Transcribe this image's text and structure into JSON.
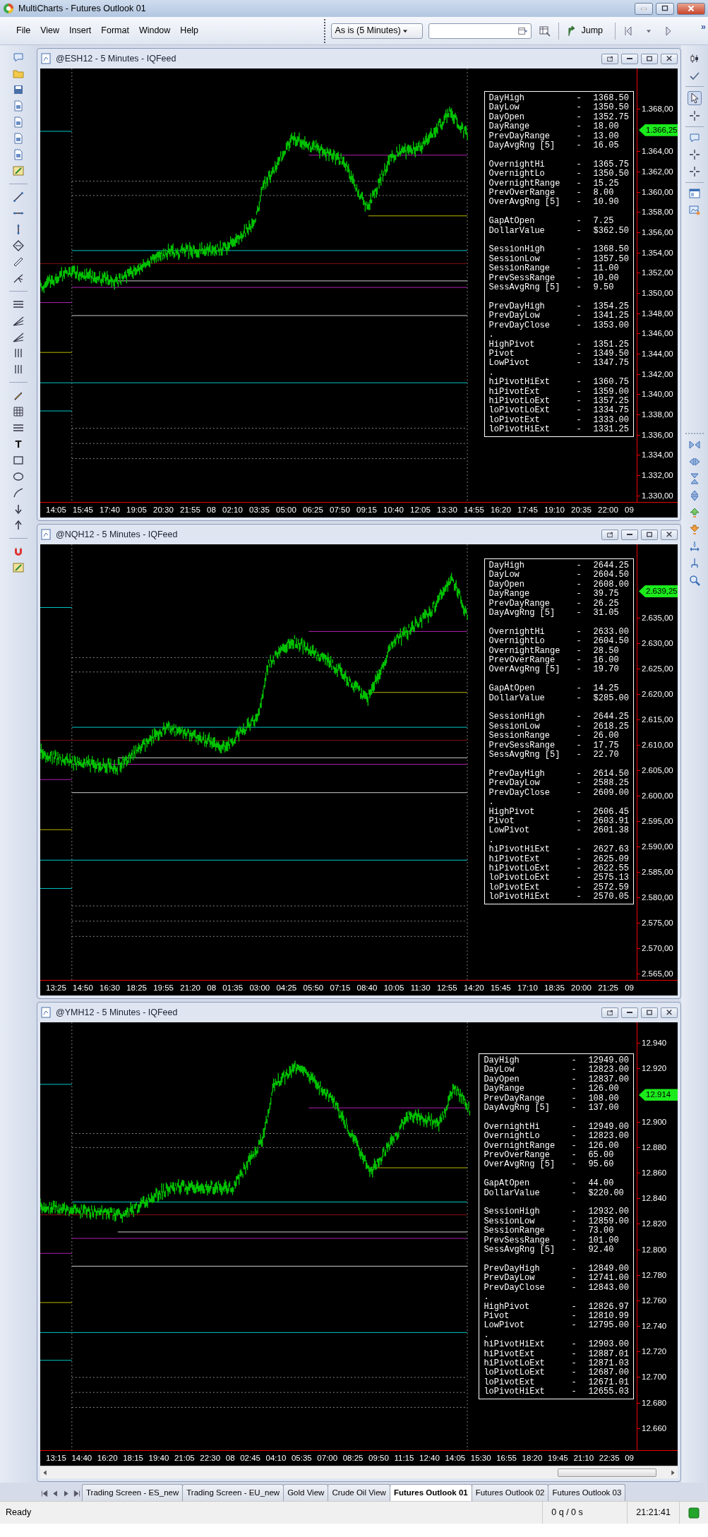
{
  "window": {
    "title": "MultiCharts - Futures Outlook 01"
  },
  "menu": [
    "File",
    "View",
    "Insert",
    "Format",
    "Window",
    "Help"
  ],
  "toolbar": {
    "resolution": "As is (5 Minutes)",
    "jump": "Jump",
    "overflow": "»"
  },
  "left_toolbar": {
    "text_tool": "T"
  },
  "charts": [
    {
      "title": "@ESH12 - 5 Minutes - IQFeed",
      "horizontal_scrollbar": false,
      "price_axis": [
        {
          "kind": "label",
          "text": "1.368,00"
        },
        {
          "kind": "last_price",
          "text": "1.366,25"
        },
        {
          "kind": "label",
          "text": "1.364,00"
        },
        {
          "kind": "label",
          "text": "1.362,00"
        },
        {
          "kind": "label",
          "text": "1.360,00"
        },
        {
          "kind": "label",
          "text": "1.358,00"
        },
        {
          "kind": "label",
          "text": "1.356,00"
        },
        {
          "kind": "label",
          "text": "1.354,00"
        },
        {
          "kind": "label",
          "text": "1.352,00"
        },
        {
          "kind": "label",
          "text": "1.350,00"
        },
        {
          "kind": "label",
          "text": "1.348,00"
        },
        {
          "kind": "label",
          "text": "1.346,00"
        },
        {
          "kind": "label",
          "text": "1.344,00"
        },
        {
          "kind": "label",
          "text": "1.342,00"
        },
        {
          "kind": "label",
          "text": "1.340,00"
        },
        {
          "kind": "label",
          "text": "1.338,00"
        },
        {
          "kind": "label",
          "text": "1.336,00"
        },
        {
          "kind": "label",
          "text": "1.334,00"
        },
        {
          "kind": "label",
          "text": "1.332,00"
        },
        {
          "kind": "label",
          "text": "1.330,00"
        }
      ],
      "time_axis": [
        "14:05",
        "15:45",
        "17:40",
        "19:05",
        "20:30",
        "21:55",
        "08",
        "02:10",
        "03:35",
        "05:00",
        "06:25",
        "07:50",
        "09:15",
        "10:40",
        "12:05",
        "13:30",
        "14:55",
        "16:20",
        "17:45",
        "19:10",
        "20:35",
        "22:00",
        "09"
      ],
      "stats": [
        {
          "kind": "row",
          "label": "DayHigh",
          "dash": "-",
          "value": "1368.50"
        },
        {
          "kind": "row",
          "label": "DayLow",
          "dash": "-",
          "value": "1350.50"
        },
        {
          "kind": "row",
          "label": "DayOpen",
          "dash": "-",
          "value": "1352.75"
        },
        {
          "kind": "row",
          "label": "DayRange",
          "dash": "-",
          "value": "18.00"
        },
        {
          "kind": "row",
          "label": "PrevDayRange",
          "dash": "-",
          "value": "13.00"
        },
        {
          "kind": "row",
          "label": "DayAvgRng [5]",
          "dash": "-",
          "value": "16.05"
        },
        {
          "kind": "blank"
        },
        {
          "kind": "row",
          "label": "OvernightHi",
          "dash": "-",
          "value": "1365.75"
        },
        {
          "kind": "row",
          "label": "OvernightLo",
          "dash": "-",
          "value": "1350.50"
        },
        {
          "kind": "row",
          "label": "OvernightRange",
          "dash": "-",
          "value": "15.25"
        },
        {
          "kind": "row",
          "label": "PrevOverRange",
          "dash": "-",
          "value": "8.00"
        },
        {
          "kind": "row",
          "label": "OverAvgRng [5]",
          "dash": "-",
          "value": "10.90"
        },
        {
          "kind": "blank"
        },
        {
          "kind": "row",
          "label": "GapAtOpen",
          "dash": "-",
          "value": "7.25"
        },
        {
          "kind": "row",
          "label": "DollarValue",
          "dash": "-",
          "value": "$362.50"
        },
        {
          "kind": "blank"
        },
        {
          "kind": "row",
          "label": "SessionHigh",
          "dash": "-",
          "value": "1368.50"
        },
        {
          "kind": "row",
          "label": "SessionLow",
          "dash": "-",
          "value": "1357.50"
        },
        {
          "kind": "row",
          "label": "SessionRange",
          "dash": "-",
          "value": "11.00"
        },
        {
          "kind": "row",
          "label": "PrevSessRange",
          "dash": "-",
          "value": "10.00"
        },
        {
          "kind": "row",
          "label": "SessAvgRng [5]",
          "dash": "-",
          "value": "9.50"
        },
        {
          "kind": "blank"
        },
        {
          "kind": "row",
          "label": "PrevDayHigh",
          "dash": "-",
          "value": "1354.25"
        },
        {
          "kind": "row",
          "label": "PrevDayLow",
          "dash": "-",
          "value": "1341.25"
        },
        {
          "kind": "row",
          "label": "PrevDayClose",
          "dash": "-",
          "value": "1353.00"
        },
        {
          "kind": "dot",
          "text": "."
        },
        {
          "kind": "row",
          "label": "HighPivot",
          "dash": "-",
          "value": "1351.25"
        },
        {
          "kind": "row",
          "label": "Pivot",
          "dash": "-",
          "value": "1349.50"
        },
        {
          "kind": "row",
          "label": "LowPivot",
          "dash": "-",
          "value": "1347.75"
        },
        {
          "kind": "dot",
          "text": "."
        },
        {
          "kind": "row",
          "label": "hiPivotHiExt",
          "dash": "-",
          "value": "1360.75"
        },
        {
          "kind": "row",
          "label": "hiPivotExt",
          "dash": "-",
          "value": "1359.00"
        },
        {
          "kind": "row",
          "label": "hiPivotLoExt",
          "dash": "-",
          "value": "1357.25"
        },
        {
          "kind": "row",
          "label": "loPivotLoExt",
          "dash": "-",
          "value": "1334.75"
        },
        {
          "kind": "row",
          "label": "loPivotExt",
          "dash": "-",
          "value": "1333.00"
        },
        {
          "kind": "row",
          "label": "loPivotHiExt",
          "dash": "-",
          "value": "1331.25"
        }
      ]
    },
    {
      "title": "@NQH12 - 5 Minutes - IQFeed",
      "horizontal_scrollbar": false,
      "price_axis": [
        {
          "kind": "last_price",
          "text": "2.639,25"
        },
        {
          "kind": "label",
          "text": "2.635,00"
        },
        {
          "kind": "label",
          "text": "2.630,00"
        },
        {
          "kind": "label",
          "text": "2.625,00"
        },
        {
          "kind": "label",
          "text": "2.620,00"
        },
        {
          "kind": "label",
          "text": "2.615,00"
        },
        {
          "kind": "label",
          "text": "2.610,00"
        },
        {
          "kind": "label",
          "text": "2.605,00"
        },
        {
          "kind": "label",
          "text": "2.600,00"
        },
        {
          "kind": "label",
          "text": "2.595,00"
        },
        {
          "kind": "label",
          "text": "2.590,00"
        },
        {
          "kind": "label",
          "text": "2.585,00"
        },
        {
          "kind": "label",
          "text": "2.580,00"
        },
        {
          "kind": "label",
          "text": "2.575,00"
        },
        {
          "kind": "label",
          "text": "2.570,00"
        },
        {
          "kind": "label",
          "text": "2.565,00"
        }
      ],
      "time_axis": [
        "13:25",
        "14:50",
        "16:30",
        "18:25",
        "19:55",
        "21:20",
        "08",
        "01:35",
        "03:00",
        "04:25",
        "05:50",
        "07:15",
        "08:40",
        "10:05",
        "11:30",
        "12:55",
        "14:20",
        "15:45",
        "17:10",
        "18:35",
        "20:00",
        "21:25",
        "09"
      ],
      "stats": [
        {
          "kind": "row",
          "label": "DayHigh",
          "dash": "-",
          "value": "2644.25"
        },
        {
          "kind": "row",
          "label": "DayLow",
          "dash": "-",
          "value": "2604.50"
        },
        {
          "kind": "row",
          "label": "DayOpen",
          "dash": "-",
          "value": "2608.00"
        },
        {
          "kind": "row",
          "label": "DayRange",
          "dash": "-",
          "value": "39.75"
        },
        {
          "kind": "row",
          "label": "PrevDayRange",
          "dash": "-",
          "value": "26.25"
        },
        {
          "kind": "row",
          "label": "DayAvgRng [5]",
          "dash": "-",
          "value": "31.05"
        },
        {
          "kind": "blank"
        },
        {
          "kind": "row",
          "label": "OvernightHi",
          "dash": "-",
          "value": "2633.00"
        },
        {
          "kind": "row",
          "label": "OvernightLo",
          "dash": "-",
          "value": "2604.50"
        },
        {
          "kind": "row",
          "label": "OvernightRange",
          "dash": "-",
          "value": "28.50"
        },
        {
          "kind": "row",
          "label": "PrevOverRange",
          "dash": "-",
          "value": "16.00"
        },
        {
          "kind": "row",
          "label": "OverAvgRng [5]",
          "dash": "-",
          "value": "19.70"
        },
        {
          "kind": "blank"
        },
        {
          "kind": "row",
          "label": "GapAtOpen",
          "dash": "-",
          "value": "14.25"
        },
        {
          "kind": "row",
          "label": "DollarValue",
          "dash": "-",
          "value": "$285.00"
        },
        {
          "kind": "blank"
        },
        {
          "kind": "row",
          "label": "SessionHigh",
          "dash": "-",
          "value": "2644.25"
        },
        {
          "kind": "row",
          "label": "SessionLow",
          "dash": "-",
          "value": "2618.25"
        },
        {
          "kind": "row",
          "label": "SessionRange",
          "dash": "-",
          "value": "26.00"
        },
        {
          "kind": "row",
          "label": "PrevSessRange",
          "dash": "-",
          "value": "17.75"
        },
        {
          "kind": "row",
          "label": "SessAvgRng [5]",
          "dash": "-",
          "value": "22.70"
        },
        {
          "kind": "blank"
        },
        {
          "kind": "row",
          "label": "PrevDayHigh",
          "dash": "-",
          "value": "2614.50"
        },
        {
          "kind": "row",
          "label": "PrevDayLow",
          "dash": "-",
          "value": "2588.25"
        },
        {
          "kind": "row",
          "label": "PrevDayClose",
          "dash": "-",
          "value": "2609.00"
        },
        {
          "kind": "dot",
          "text": "."
        },
        {
          "kind": "row",
          "label": "HighPivot",
          "dash": "-",
          "value": "2606.45"
        },
        {
          "kind": "row",
          "label": "Pivot",
          "dash": "-",
          "value": "2603.91"
        },
        {
          "kind": "row",
          "label": "LowPivot",
          "dash": "-",
          "value": "2601.38"
        },
        {
          "kind": "dot",
          "text": "."
        },
        {
          "kind": "row",
          "label": "hiPivotHiExt",
          "dash": "-",
          "value": "2627.63"
        },
        {
          "kind": "row",
          "label": "hiPivotExt",
          "dash": "-",
          "value": "2625.09"
        },
        {
          "kind": "row",
          "label": "hiPivotLoExt",
          "dash": "-",
          "value": "2622.55"
        },
        {
          "kind": "row",
          "label": "loPivotLoExt",
          "dash": "-",
          "value": "2575.13"
        },
        {
          "kind": "row",
          "label": "loPivotExt",
          "dash": "-",
          "value": "2572.59"
        },
        {
          "kind": "row",
          "label": "loPivotHiExt",
          "dash": "-",
          "value": "2570.05"
        }
      ]
    },
    {
      "title": "@YMH12 - 5 Minutes - IQFeed",
      "horizontal_scrollbar": true,
      "price_axis": [
        {
          "kind": "label",
          "text": "12.940"
        },
        {
          "kind": "label",
          "text": "12.920"
        },
        {
          "kind": "last_price",
          "text": "12.914"
        },
        {
          "kind": "label",
          "text": "12.900"
        },
        {
          "kind": "label",
          "text": "12.880"
        },
        {
          "kind": "label",
          "text": "12.860"
        },
        {
          "kind": "label",
          "text": "12.840"
        },
        {
          "kind": "label",
          "text": "12.820"
        },
        {
          "kind": "label",
          "text": "12.800"
        },
        {
          "kind": "label",
          "text": "12.780"
        },
        {
          "kind": "label",
          "text": "12.760"
        },
        {
          "kind": "label",
          "text": "12.740"
        },
        {
          "kind": "label",
          "text": "12.720"
        },
        {
          "kind": "label",
          "text": "12.700"
        },
        {
          "kind": "label",
          "text": "12.680"
        },
        {
          "kind": "label",
          "text": "12.660"
        }
      ],
      "time_axis": [
        "13:15",
        "14:40",
        "16:20",
        "18:15",
        "19:40",
        "21:05",
        "22:30",
        "08",
        "02:45",
        "04:10",
        "05:35",
        "07:00",
        "08:25",
        "09:50",
        "11:15",
        "12:40",
        "14:05",
        "15:30",
        "16:55",
        "18:20",
        "19:45",
        "21:10",
        "22:35",
        "09"
      ],
      "stats": [
        {
          "kind": "row",
          "label": "DayHigh",
          "dash": "-",
          "value": "12949.00"
        },
        {
          "kind": "row",
          "label": "DayLow",
          "dash": "-",
          "value": "12823.00"
        },
        {
          "kind": "row",
          "label": "DayOpen",
          "dash": "-",
          "value": "12837.00"
        },
        {
          "kind": "row",
          "label": "DayRange",
          "dash": "-",
          "value": "126.00"
        },
        {
          "kind": "row",
          "label": "PrevDayRange",
          "dash": "-",
          "value": "108.00"
        },
        {
          "kind": "row",
          "label": "DayAvgRng [5]",
          "dash": "-",
          "value": "137.00"
        },
        {
          "kind": "blank"
        },
        {
          "kind": "row",
          "label": "OvernightHi",
          "dash": "-",
          "value": "12949.00"
        },
        {
          "kind": "row",
          "label": "OvernightLo",
          "dash": "-",
          "value": "12823.00"
        },
        {
          "kind": "row",
          "label": "OvernightRange",
          "dash": "-",
          "value": "126.00"
        },
        {
          "kind": "row",
          "label": "PrevOverRange",
          "dash": "-",
          "value": "65.00"
        },
        {
          "kind": "row",
          "label": "OverAvgRng [5]",
          "dash": "-",
          "value": "95.60"
        },
        {
          "kind": "blank"
        },
        {
          "kind": "row",
          "label": "GapAtOpen",
          "dash": "-",
          "value": "44.00"
        },
        {
          "kind": "row",
          "label": "DollarValue",
          "dash": "-",
          "value": "$220.00"
        },
        {
          "kind": "blank"
        },
        {
          "kind": "row",
          "label": "SessionHigh",
          "dash": "-",
          "value": "12932.00"
        },
        {
          "kind": "row",
          "label": "SessionLow",
          "dash": "-",
          "value": "12859.00"
        },
        {
          "kind": "row",
          "label": "SessionRange",
          "dash": "-",
          "value": "73.00"
        },
        {
          "kind": "row",
          "label": "PrevSessRange",
          "dash": "-",
          "value": "101.00"
        },
        {
          "kind": "row",
          "label": "SessAvgRng [5]",
          "dash": "-",
          "value": "92.40"
        },
        {
          "kind": "blank"
        },
        {
          "kind": "row",
          "label": "PrevDayHigh",
          "dash": "-",
          "value": "12849.00"
        },
        {
          "kind": "row",
          "label": "PrevDayLow",
          "dash": "-",
          "value": "12741.00"
        },
        {
          "kind": "row",
          "label": "PrevDayClose",
          "dash": "-",
          "value": "12843.00"
        },
        {
          "kind": "dot",
          "text": "."
        },
        {
          "kind": "row",
          "label": "HighPivot",
          "dash": "-",
          "value": "12826.97"
        },
        {
          "kind": "row",
          "label": "Pivot",
          "dash": "-",
          "value": "12810.99"
        },
        {
          "kind": "row",
          "label": "LowPivot",
          "dash": "-",
          "value": "12795.00"
        },
        {
          "kind": "dot",
          "text": "."
        },
        {
          "kind": "row",
          "label": "hiPivotHiExt",
          "dash": "-",
          "value": "12903.00"
        },
        {
          "kind": "row",
          "label": "hiPivotExt",
          "dash": "-",
          "value": "12887.01"
        },
        {
          "kind": "row",
          "label": "hiPivotLoExt",
          "dash": "-",
          "value": "12871.03"
        },
        {
          "kind": "row",
          "label": "loPivotLoExt",
          "dash": "-",
          "value": "12687.00"
        },
        {
          "kind": "row",
          "label": "loPivotExt",
          "dash": "-",
          "value": "12671.01"
        },
        {
          "kind": "row",
          "label": "loPivotHiExt",
          "dash": "-",
          "value": "12655.03"
        }
      ]
    }
  ],
  "sheet_tabs": [
    {
      "label": "Trading Screen - ES_new",
      "selected": false
    },
    {
      "label": "Trading Screen - EU_new",
      "selected": false
    },
    {
      "label": "Gold View",
      "selected": false
    },
    {
      "label": "Crude Oil View",
      "selected": false
    },
    {
      "label": "Futures Outlook 01",
      "selected": true
    },
    {
      "label": "Futures Outlook 02",
      "selected": false
    },
    {
      "label": "Futures Outlook 03",
      "selected": false
    }
  ],
  "status_bar": {
    "text": "Ready",
    "queue": "0 q / 0 s",
    "time": "21:21:41"
  }
}
